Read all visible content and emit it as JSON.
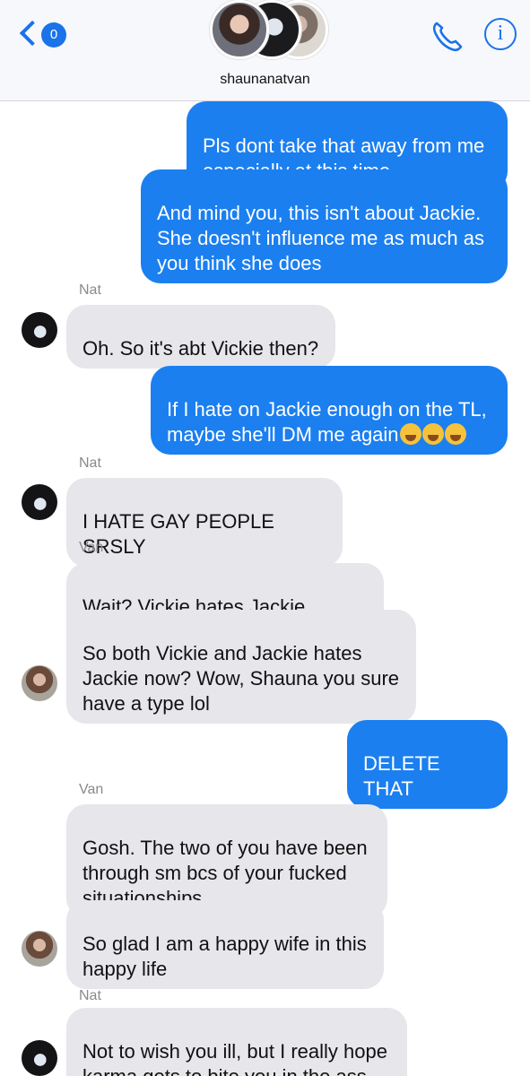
{
  "header": {
    "back_badge": "0",
    "group_name": "shaunanatvan",
    "info_label": "i"
  },
  "messages": [
    {
      "sender": "",
      "text": "Pls dont take that away from me\nespecially at this time"
    },
    {
      "sender": "",
      "text": "And mind you, this isn't about Jackie.\nShe doesn't influence me as much as\nyou think she does"
    },
    {
      "sender": "Nat",
      "text": "Oh. So it's abt Vickie then?"
    },
    {
      "sender": "",
      "text": "If I hate on Jackie enough on the TL,\nmaybe she'll DM me again",
      "emoji": "loudly-crying-face x3"
    },
    {
      "sender": "Nat",
      "text": "I HATE GAY PEOPLE SRSLY"
    },
    {
      "sender": "Van",
      "text": "Wait? Vickie hates Jackie now??"
    },
    {
      "sender": "",
      "text": "So both Vickie and Jackie hates\nJackie now? Wow, Shauna you sure\nhave a type lol"
    },
    {
      "sender": "",
      "text": "DELETE THAT"
    },
    {
      "sender": "Van",
      "text": "Gosh. The two of you have been\nthrough sm bcs of your fucked\nsituationships"
    },
    {
      "sender": "",
      "text": "So glad I am a happy wife in this\nhappy life"
    },
    {
      "sender": "Nat",
      "text": "Not to wish you ill, but I really hope\nkarma gets to bite you in the ass"
    }
  ],
  "colors": {
    "sent_bubble": "#1b7ff0",
    "received_bubble": "#e6e6eb",
    "accent": "#1a73e8"
  }
}
